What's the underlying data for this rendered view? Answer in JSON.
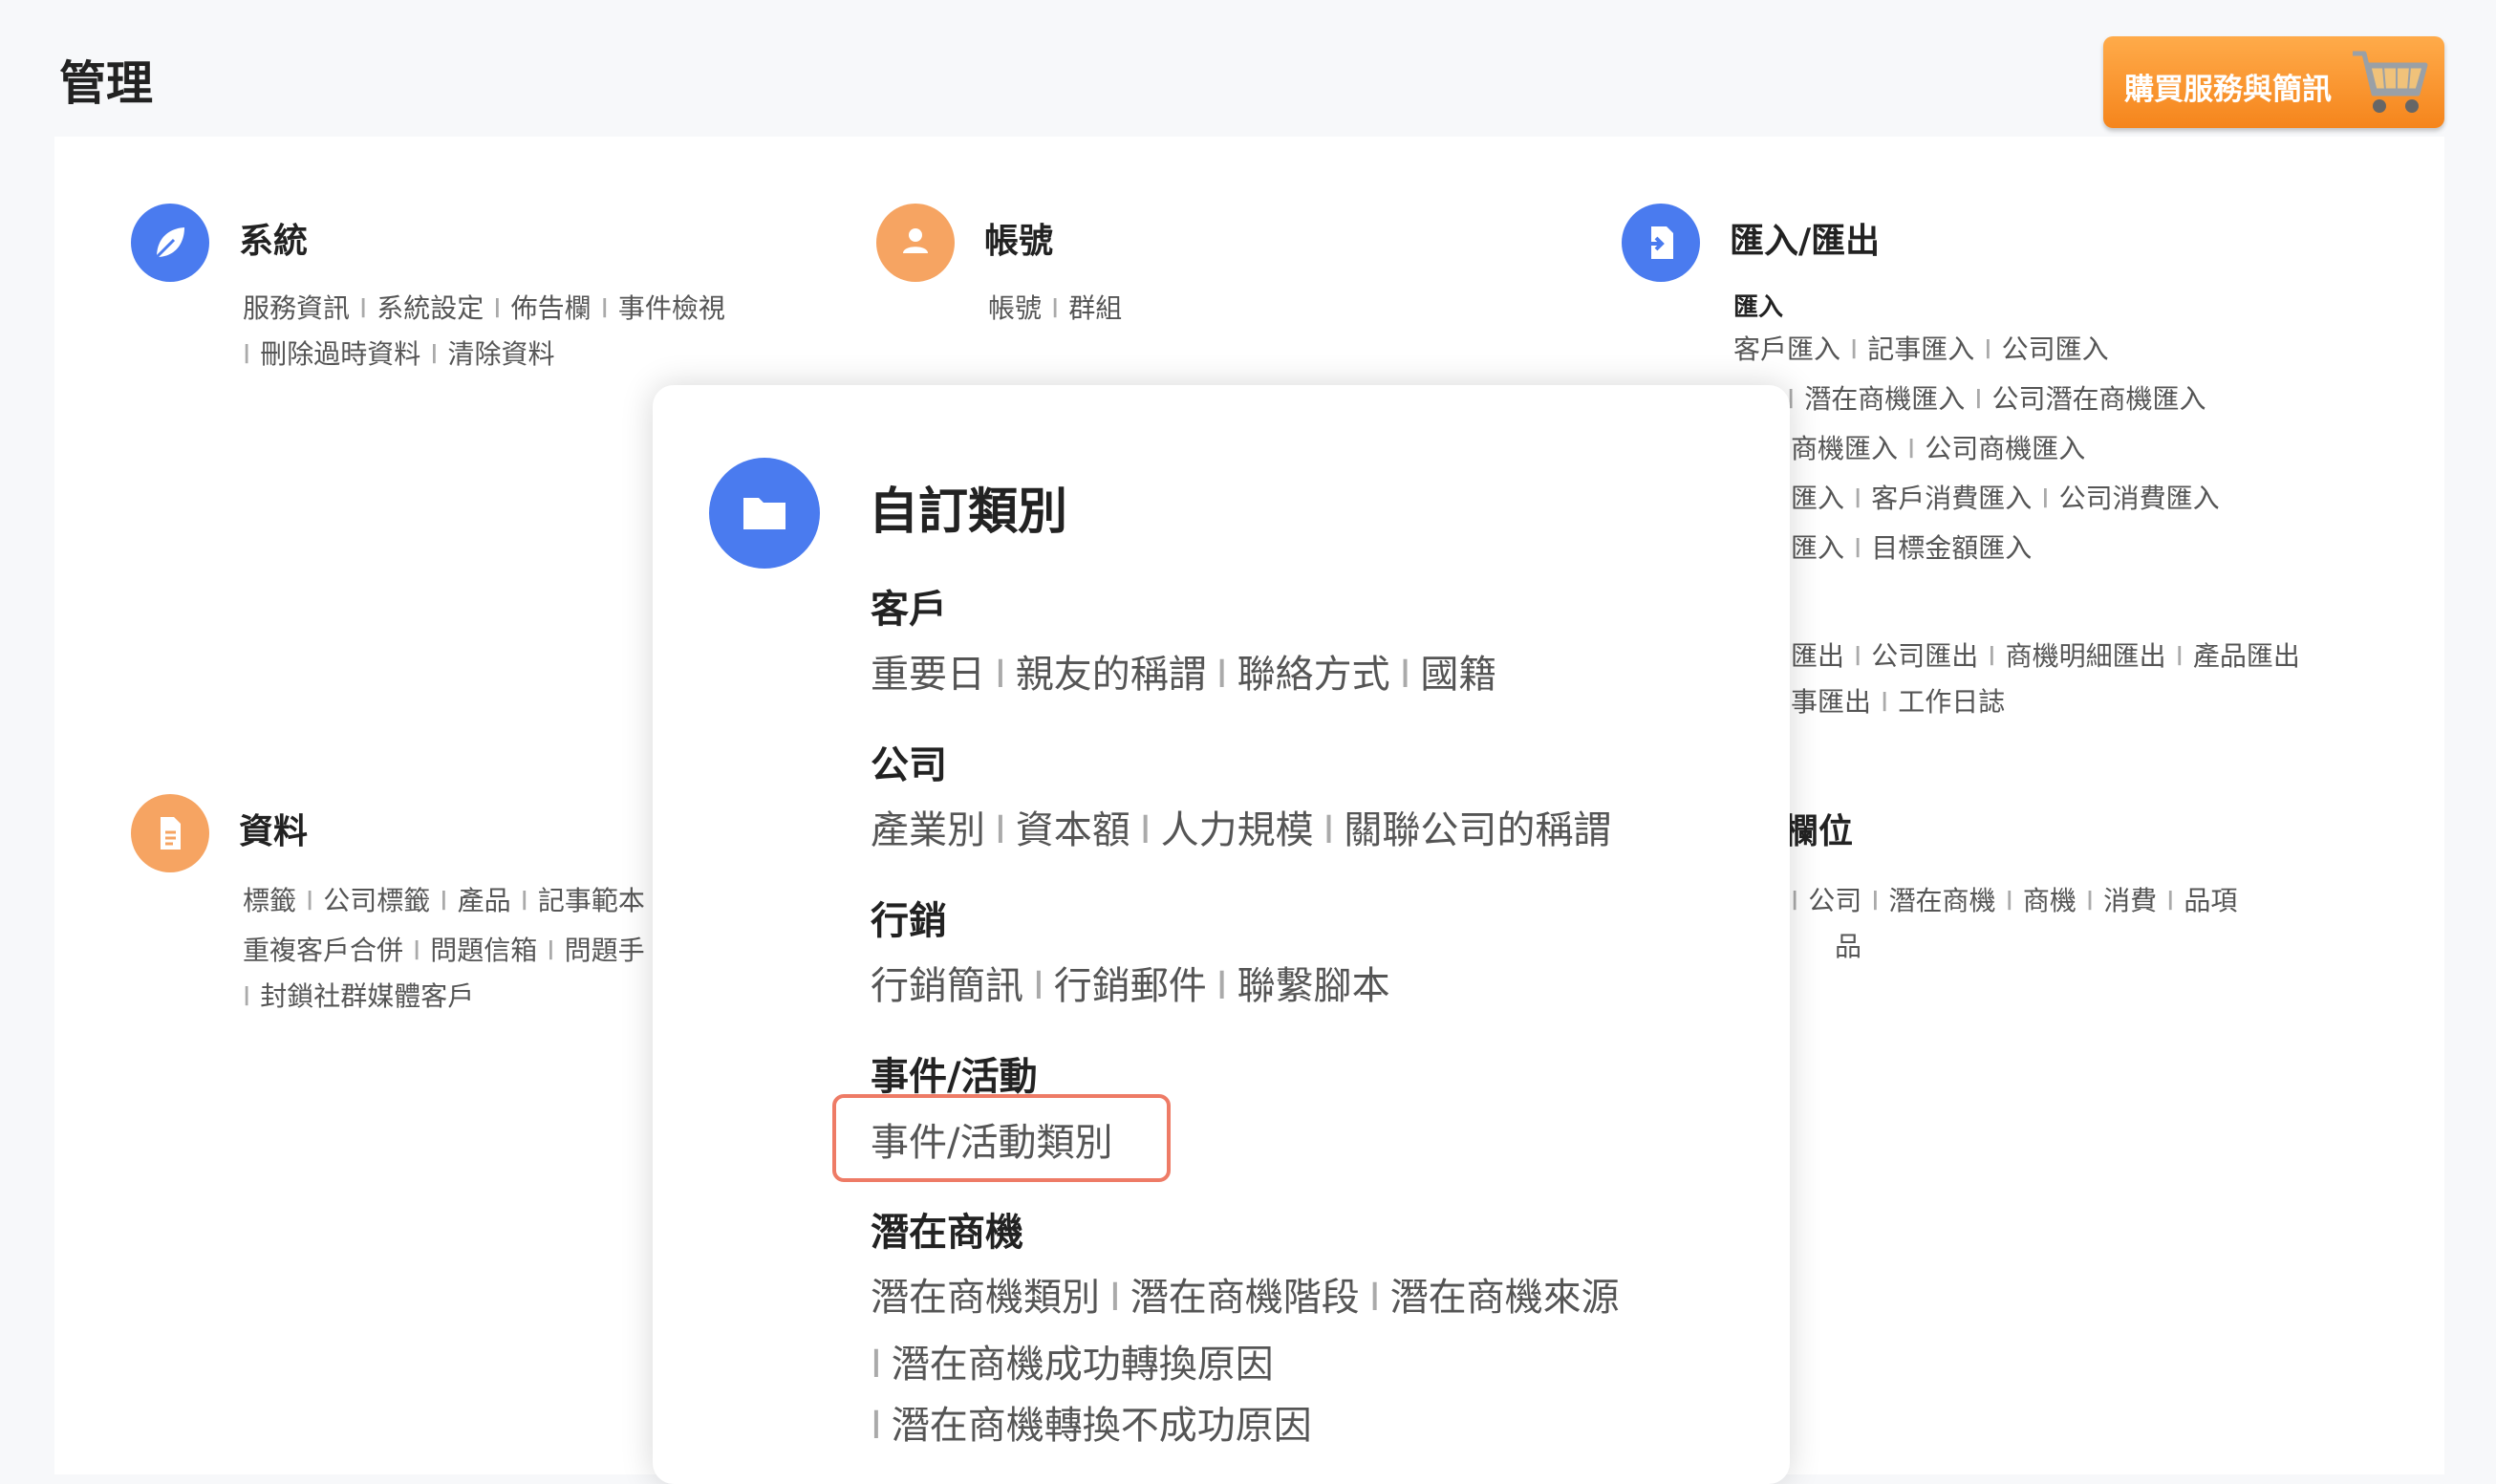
{
  "page": {
    "title": "管理"
  },
  "buy": {
    "label": "購買服務與簡訊",
    "icon": "shopping-cart-icon",
    "color": "#f7921e"
  },
  "system": {
    "title": "系統",
    "icon": "leaf-icon",
    "line1": [
      "服務資訊",
      "系統設定",
      "佈告欄",
      "事件檢視"
    ],
    "line2": [
      "刪除過時資料",
      "清除資料"
    ]
  },
  "account": {
    "title": "帳號",
    "icon": "user-icon",
    "line1": [
      "帳號",
      "群組"
    ]
  },
  "import_export": {
    "title": "匯入/匯出",
    "icon": "import-file-icon",
    "import_heading": "匯入",
    "line1": [
      "客戶匯入",
      "記事匯入",
      "公司匯入"
    ],
    "line2": [
      "潛在商機匯入",
      "公司潛在商機匯入"
    ],
    "line3": [
      "商機匯入",
      "公司商機匯入"
    ],
    "line4_start": "匯入",
    "line4": [
      "客戶消費匯入",
      "公司消費匯入"
    ],
    "line5_start": "匯入",
    "line5": [
      "目標金額匯入"
    ],
    "export_line1_start": "匯出",
    "export_line1": [
      "公司匯出",
      "商機明細匯出",
      "產品匯出"
    ],
    "export_line2_start": "事匯出",
    "export_line2": [
      "工作日誌"
    ]
  },
  "data": {
    "title": "資料",
    "icon": "document-icon",
    "line1": [
      "標籤",
      "公司標籤",
      "產品",
      "記事範本"
    ],
    "line2": [
      "重複客戶合併",
      "問題信箱",
      "問題手"
    ],
    "line3": [
      "封鎖社群媒體客戶"
    ]
  },
  "fields": {
    "title_partial": "欄位",
    "line1": [
      "公司",
      "潛在商機",
      "商機",
      "消費",
      "品項"
    ],
    "line2_partial": "品"
  },
  "popup": {
    "title": "自訂類別",
    "icon": "folder-icon",
    "groups": {
      "customer": {
        "heading": "客戶",
        "items": [
          "重要日",
          "親友的稱謂",
          "聯絡方式",
          "國籍"
        ]
      },
      "company": {
        "heading": "公司",
        "items": [
          "產業別",
          "資本額",
          "人力規模",
          "關聯公司的稱謂"
        ]
      },
      "marketing": {
        "heading": "行銷",
        "items": [
          "行銷簡訊",
          "行銷郵件",
          "聯繫腳本"
        ]
      },
      "event": {
        "heading": "事件/活動",
        "items": [
          "事件/活動類別"
        ]
      },
      "lead": {
        "heading": "潛在商機",
        "items": [
          "潛在商機類別",
          "潛在商機階段",
          "潛在商機來源",
          "潛在商機成功轉換原因",
          "潛在商機轉換不成功原因"
        ]
      }
    },
    "highlight_color": "#ee7b66"
  },
  "colors": {
    "blue_icon": "#4a7bef",
    "orange_icon": "#f6a462"
  }
}
